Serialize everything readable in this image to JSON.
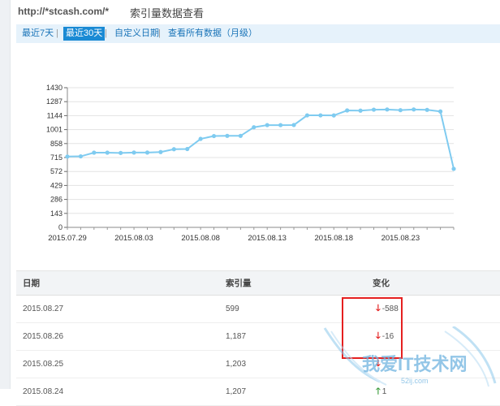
{
  "header": {
    "url": "http://*stcash.com/*",
    "title": "索引量数据查看"
  },
  "tabs": [
    {
      "label": "最近7天",
      "active": false
    },
    {
      "label": "最近30天",
      "active": true
    },
    {
      "label": "自定义日期",
      "active": false
    },
    {
      "label": "查看所有数据（月级）",
      "active": false
    }
  ],
  "colors": {
    "line": "#7fcbf0",
    "tab_active": "#1a8ad4",
    "decrease": "#e21515",
    "increase": "#3a9b3a",
    "highlight_box": "#e52020"
  },
  "chart_data": {
    "type": "line",
    "x": [
      "2015.07.29",
      "2015.07.30",
      "2015.07.31",
      "2015.08.01",
      "2015.08.02",
      "2015.08.03",
      "2015.08.04",
      "2015.08.05",
      "2015.08.06",
      "2015.08.07",
      "2015.08.08",
      "2015.08.09",
      "2015.08.10",
      "2015.08.11",
      "2015.08.12",
      "2015.08.13",
      "2015.08.14",
      "2015.08.15",
      "2015.08.16",
      "2015.08.17",
      "2015.08.18",
      "2015.08.19",
      "2015.08.20",
      "2015.08.21",
      "2015.08.22",
      "2015.08.23",
      "2015.08.24",
      "2015.08.25",
      "2015.08.26",
      "2015.08.27"
    ],
    "series": [
      {
        "values": [
          725,
          727,
          765,
          765,
          762,
          766,
          766,
          771,
          800,
          802,
          906,
          935,
          937,
          937,
          1025,
          1047,
          1047,
          1048,
          1147,
          1147,
          1146,
          1197,
          1195,
          1205,
          1207,
          1200,
          1207,
          1203,
          1187,
          599
        ]
      }
    ],
    "y_ticks": [
      0,
      143,
      286,
      429,
      572,
      715,
      858,
      1001,
      1144,
      1287,
      1430
    ],
    "ylim": [
      0,
      1430
    ],
    "x_ticks": [
      "2015.07.29",
      "2015.08.03",
      "2015.08.08",
      "2015.08.13",
      "2015.08.18",
      "2015.08.23"
    ],
    "grid": "horizontal"
  },
  "table": {
    "headers": [
      "日期",
      "索引量",
      "变化"
    ],
    "rows": [
      {
        "date": "2015.08.27",
        "value": "599",
        "direction": "down",
        "change": "-588"
      },
      {
        "date": "2015.08.26",
        "value": "1,187",
        "direction": "down",
        "change": "-16"
      },
      {
        "date": "2015.08.25",
        "value": "1,203",
        "direction": "down",
        "change": ""
      },
      {
        "date": "2015.08.24",
        "value": "1,207",
        "direction": "up",
        "change": "1"
      }
    ]
  },
  "watermark": {
    "text": "我爱IT技术网",
    "url": "52ij.com"
  }
}
